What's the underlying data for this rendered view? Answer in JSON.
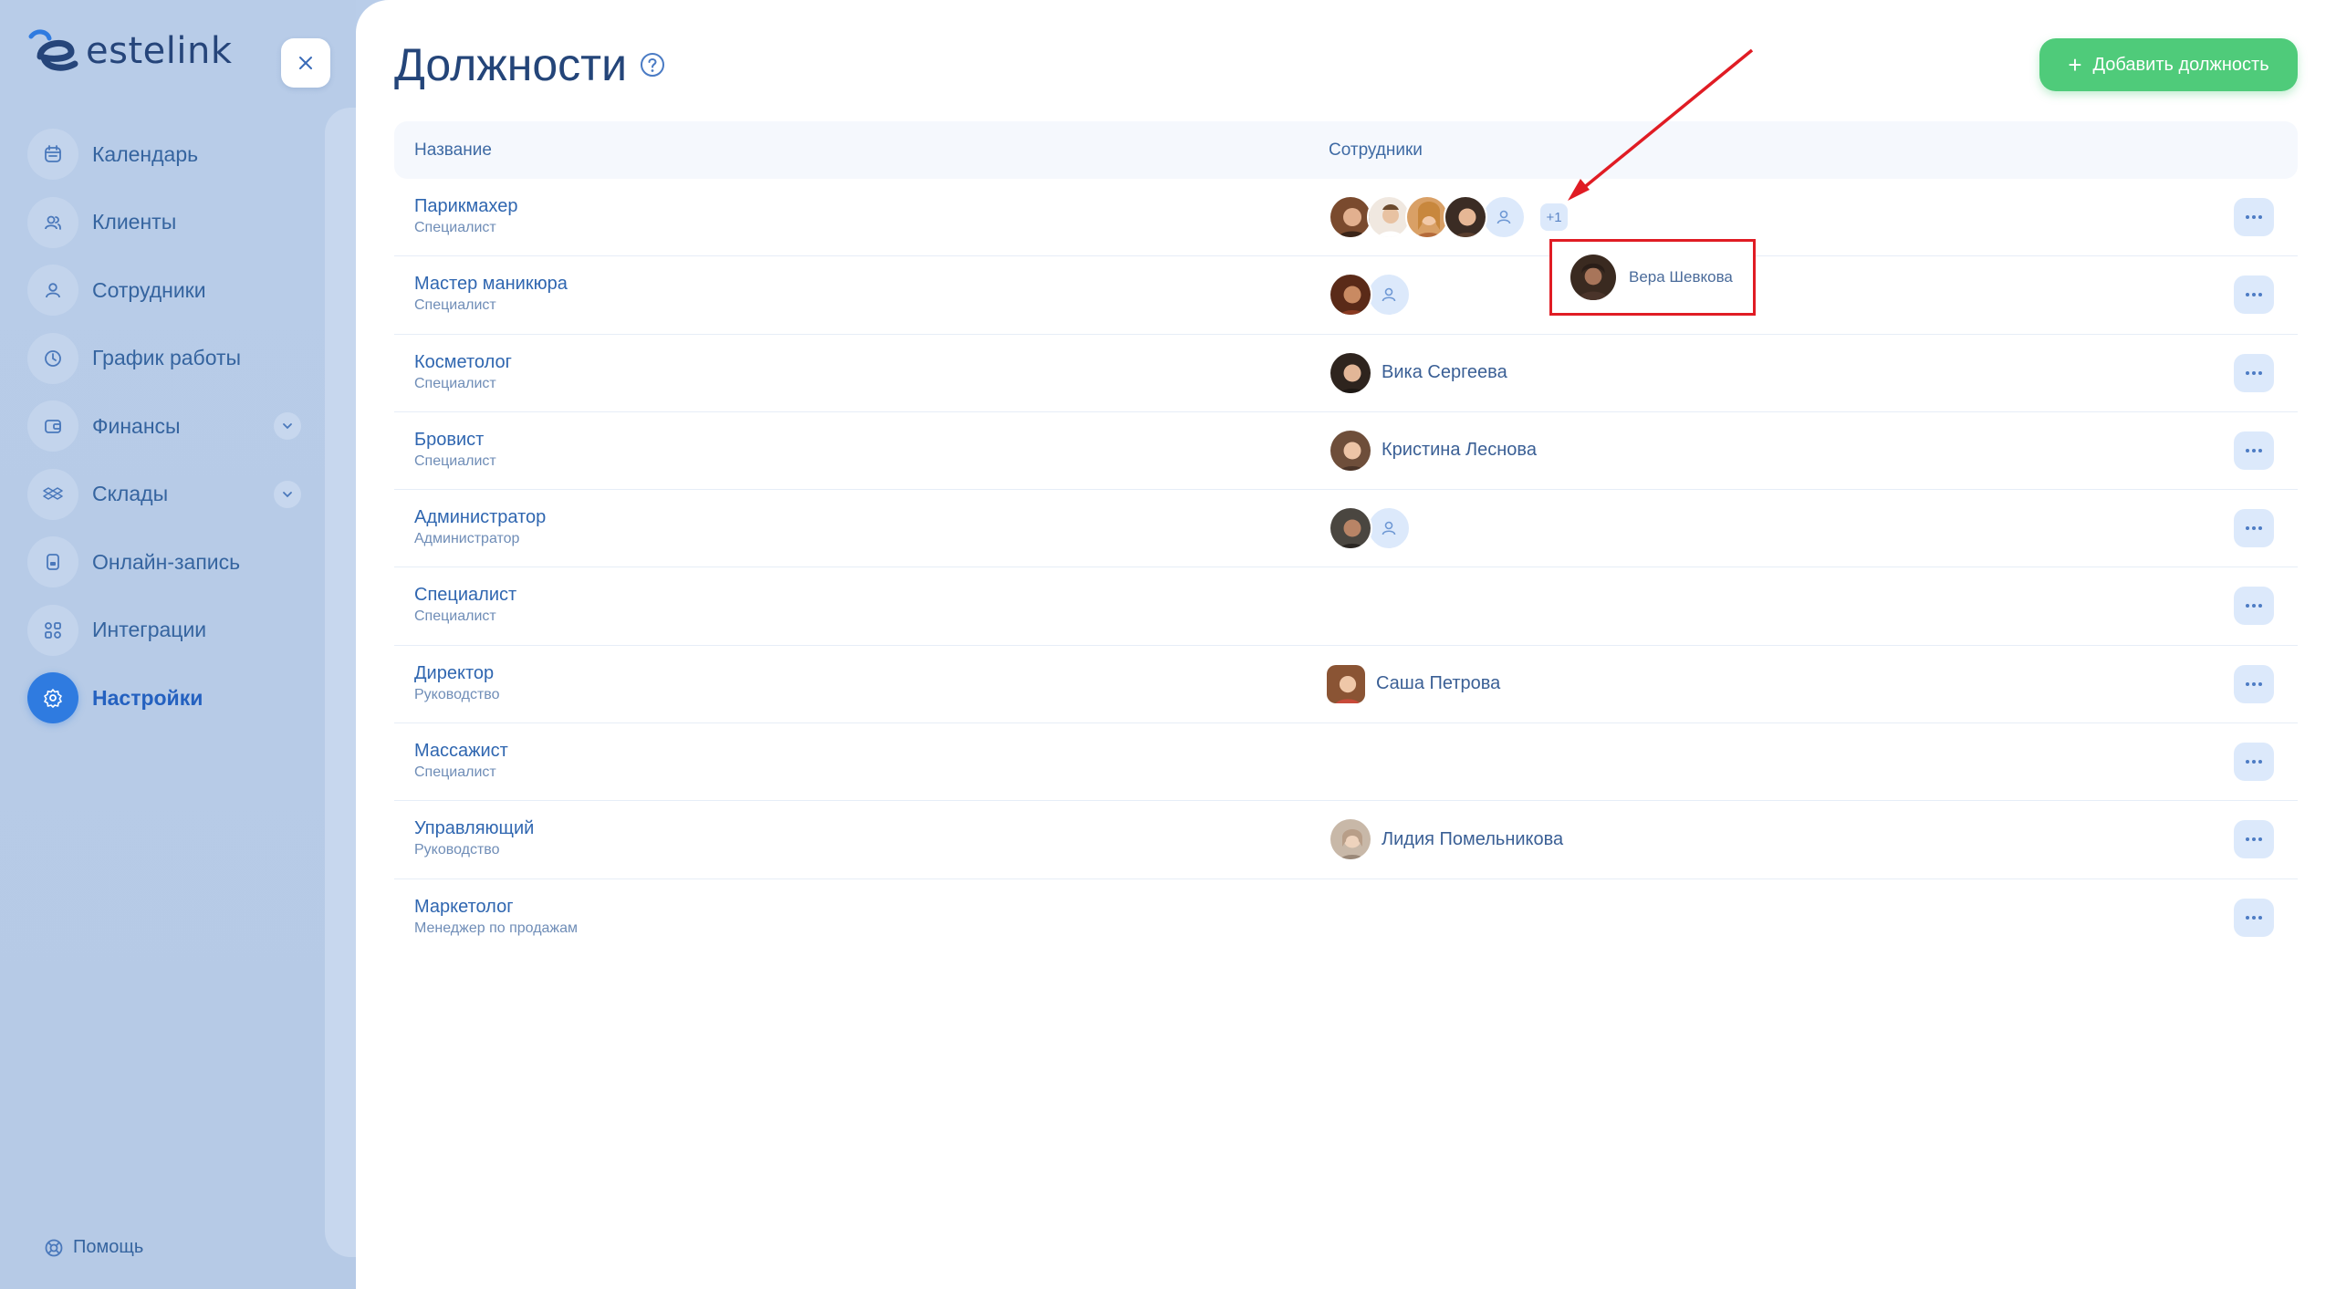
{
  "app": {
    "brand": "estelink",
    "accent_color": "#2f7be0",
    "success_color": "#4fcb7a"
  },
  "sidebar": {
    "items": [
      {
        "label": "Календарь",
        "icon": "calendar-icon"
      },
      {
        "label": "Клиенты",
        "icon": "users-icon"
      },
      {
        "label": "Сотрудники",
        "icon": "user-icon"
      },
      {
        "label": "График работы",
        "icon": "clock-icon"
      },
      {
        "label": "Финансы",
        "icon": "wallet-icon",
        "has_submenu": true
      },
      {
        "label": "Склады",
        "icon": "dropbox-icon",
        "has_submenu": true
      },
      {
        "label": "Онлайн-запись",
        "icon": "phone-icon"
      },
      {
        "label": "Интеграции",
        "icon": "grid-icon"
      },
      {
        "label": "Настройки",
        "icon": "gear-icon",
        "active": true
      }
    ],
    "help_label": "Помощь"
  },
  "page": {
    "title": "Должности",
    "add_button_label": "Добавить должность"
  },
  "table": {
    "columns": [
      "Название",
      "Сотрудники"
    ],
    "rows": [
      {
        "name": "Парикмахер",
        "category": "Специалист",
        "employees": [
          "avatar",
          "avatar",
          "avatar",
          "avatar",
          "placeholder"
        ],
        "more": "+1"
      },
      {
        "name": "Мастер маникюра",
        "category": "Специалист",
        "employees": [
          "avatar",
          "placeholder"
        ]
      },
      {
        "name": "Косметолог",
        "category": "Специалист",
        "employee_name": "Вика Сергеева"
      },
      {
        "name": "Бровист",
        "category": "Специалист",
        "employee_name": "Кристина Леснова"
      },
      {
        "name": "Администратор",
        "category": "Администратор",
        "employees": [
          "avatar",
          "placeholder"
        ]
      },
      {
        "name": "Специалист",
        "category": "Специалист"
      },
      {
        "name": "Директор",
        "category": "Руководство",
        "employee_name": "Саша Петрова"
      },
      {
        "name": "Массажист",
        "category": "Специалист"
      },
      {
        "name": "Управляющий",
        "category": "Руководство",
        "employee_name": "Лидия Помельникова"
      },
      {
        "name": "Маркетолог",
        "category": "Менеджер по продажам"
      }
    ]
  },
  "tooltip": {
    "employee_name": "Вера Шевкова",
    "highlight_color": "#e01c24"
  }
}
